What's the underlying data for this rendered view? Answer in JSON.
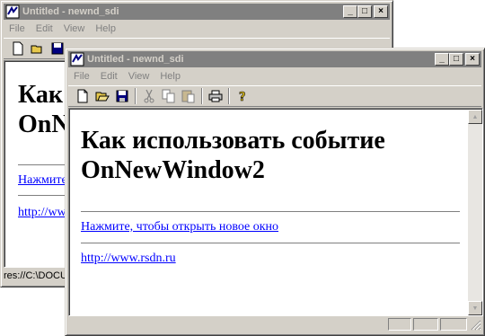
{
  "back_window": {
    "title": "Untitled - newnd_sdi",
    "heading_partial": "Как\nOnN",
    "link_partial": "Нажмите",
    "url_partial": "http://www",
    "status": "res://C:\\DOCUMENTS"
  },
  "front_window": {
    "title": "Untitled - newnd_sdi",
    "heading": "Как использовать событие OnNewWindow2",
    "link_text": "Нажмите, чтобы открыть новое окно",
    "url_text": "http://www.rsdn.ru"
  },
  "menu": [
    "File",
    "Edit",
    "View",
    "Help"
  ],
  "title_buttons": {
    "minimize": "_",
    "maximize": "□",
    "close": "×"
  },
  "toolbar_icons": [
    "new-icon",
    "open-icon",
    "save-icon",
    "cut-icon",
    "copy-icon",
    "paste-icon",
    "print-icon",
    "help-icon"
  ],
  "colors": {
    "face": "#d4d0c8",
    "inactive_title": "#808080",
    "link": "#0000ff"
  }
}
